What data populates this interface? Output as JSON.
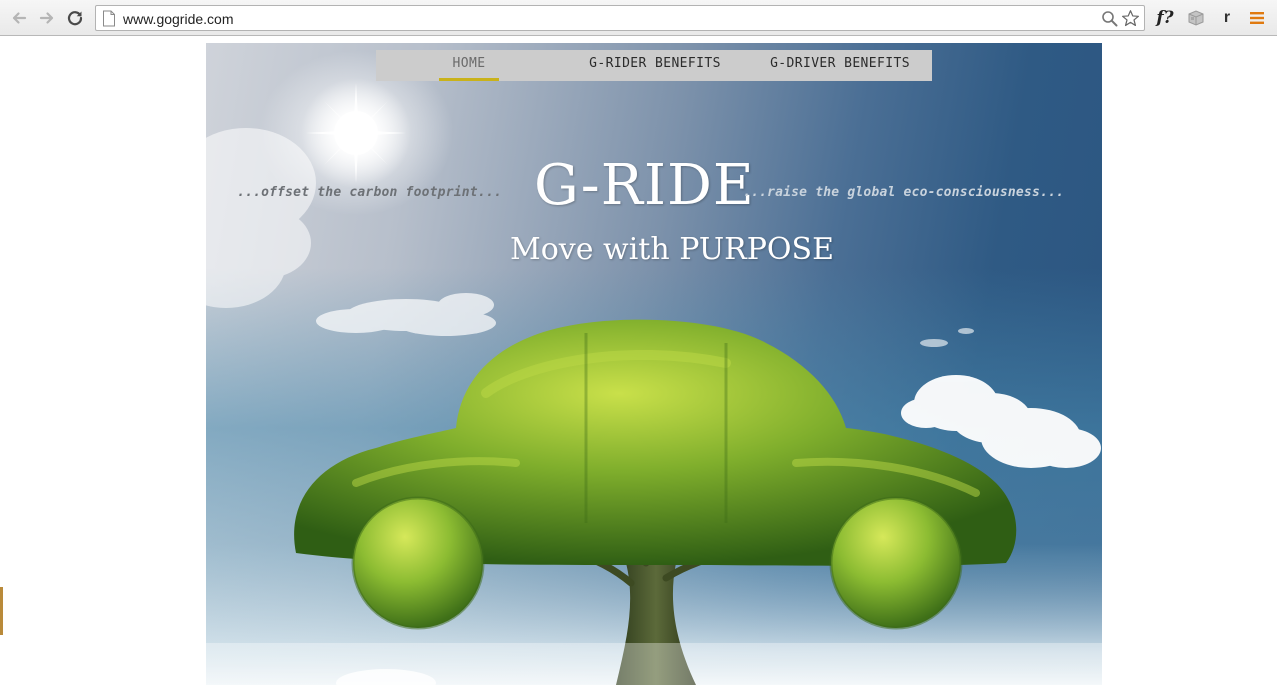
{
  "browser": {
    "url": "www.gogride.com",
    "extensions": {
      "formula_label": "f?",
      "r_label": "r"
    },
    "icons": [
      "back-arrow-icon",
      "forward-arrow-icon",
      "reload-icon",
      "page-icon",
      "zoom-icon",
      "bookmark-star-icon",
      "cube-icon",
      "hamburger-menu-icon"
    ]
  },
  "page": {
    "nav": {
      "items": [
        {
          "label": "HOME",
          "active": true
        },
        {
          "label": "G-RIDER BENEFITS",
          "active": false
        },
        {
          "label": "G-DRIVER BENEFITS",
          "active": false
        }
      ]
    },
    "hero": {
      "brand": "G-RIDE",
      "motto": "Move with PURPOSE",
      "tagline_left": "...offset the carbon footprint...",
      "tagline_right": "...raise the global eco-consciousness..."
    },
    "colors": {
      "nav_bg": "#cccccc",
      "active_underline": "#c9b21a",
      "sky_dark": "#2b5581",
      "foliage": "#6f9a2a"
    }
  }
}
